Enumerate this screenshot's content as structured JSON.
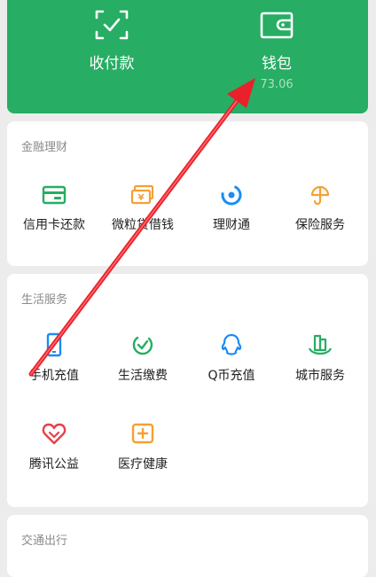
{
  "colors": {
    "green": "#27ad64",
    "orange": "#f4a035",
    "blue": "#1b8cf5",
    "red": "#e7414a",
    "annotation": "#e8212b"
  },
  "top_actions": [
    {
      "label": "收付款",
      "icon": "scan-pay-icon"
    },
    {
      "label": "钱包",
      "icon": "wallet-icon",
      "balance": "73.06"
    }
  ],
  "finance": {
    "title": "金融理财",
    "items": [
      {
        "label": "信用卡还款",
        "icon": "credit-card-icon"
      },
      {
        "label": "微粒贷借钱",
        "icon": "loan-icon"
      },
      {
        "label": "理财通",
        "icon": "wealth-icon"
      },
      {
        "label": "保险服务",
        "icon": "insurance-icon"
      }
    ]
  },
  "life": {
    "title": "生活服务",
    "items": [
      {
        "label": "手机充值",
        "icon": "phone-recharge-icon"
      },
      {
        "label": "生活缴费",
        "icon": "bill-payment-icon"
      },
      {
        "label": "Q币充值",
        "icon": "qq-coin-icon"
      },
      {
        "label": "城市服务",
        "icon": "city-service-icon"
      },
      {
        "label": "腾讯公益",
        "icon": "charity-icon"
      },
      {
        "label": "医疗健康",
        "icon": "healthcare-icon"
      }
    ]
  },
  "transport": {
    "title": "交通出行"
  }
}
